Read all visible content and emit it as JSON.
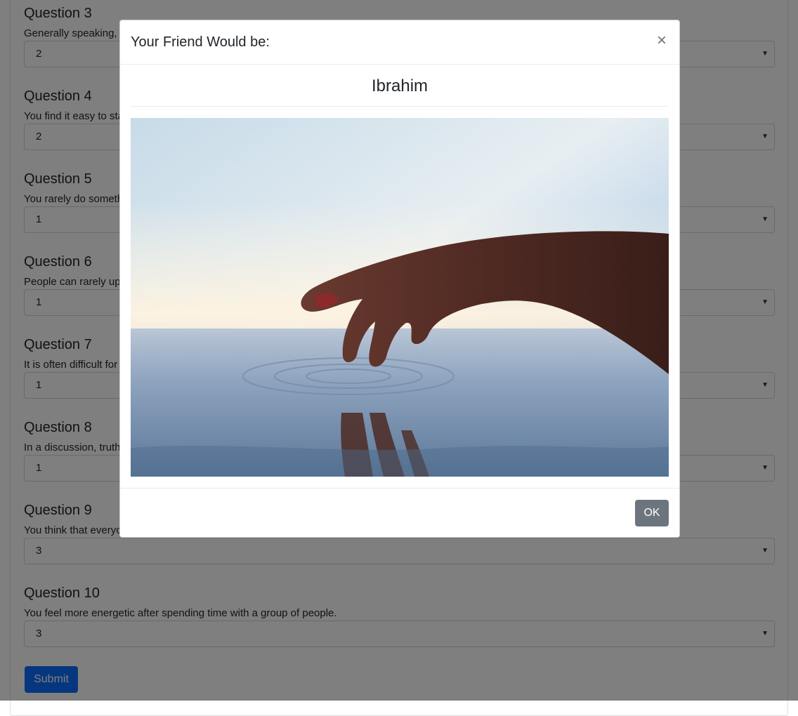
{
  "questions": [
    {
      "title": "Question 3",
      "text": "Generally speaking, you rely more on your experience than your imagination.",
      "value": "2"
    },
    {
      "title": "Question 4",
      "text": "You find it easy to stay relaxed and focused even when there is some pressure.",
      "value": "2"
    },
    {
      "title": "Question 5",
      "text": "You rarely do something just out of sheer curiosity.",
      "value": "1"
    },
    {
      "title": "Question 6",
      "text": "People can rarely upset you.",
      "value": "1"
    },
    {
      "title": "Question 7",
      "text": "It is often difficult for you to relate to other people's feelings.",
      "value": "1"
    },
    {
      "title": "Question 8",
      "text": "In a discussion, truth should be more important than people's sensitivities.",
      "value": "1"
    },
    {
      "title": "Question 9",
      "text": "You think that everyone's views should be respected regardless of whether they are supported by facts or not.",
      "value": "3"
    },
    {
      "title": "Question 10",
      "text": "You feel more energetic after spending time with a group of people.",
      "value": "3"
    }
  ],
  "submit_label": "Submit",
  "modal": {
    "title": "Your Friend Would be:",
    "close_label": "×",
    "friend_name": "Ibrahim",
    "ok_label": "OK"
  },
  "icons": {
    "close": "close-icon",
    "dropdown": "chevron-down-icon"
  },
  "colors": {
    "primary": "#0d6efd",
    "secondary": "#6c757d",
    "backdrop": "rgba(0,0,0,0.5)"
  }
}
